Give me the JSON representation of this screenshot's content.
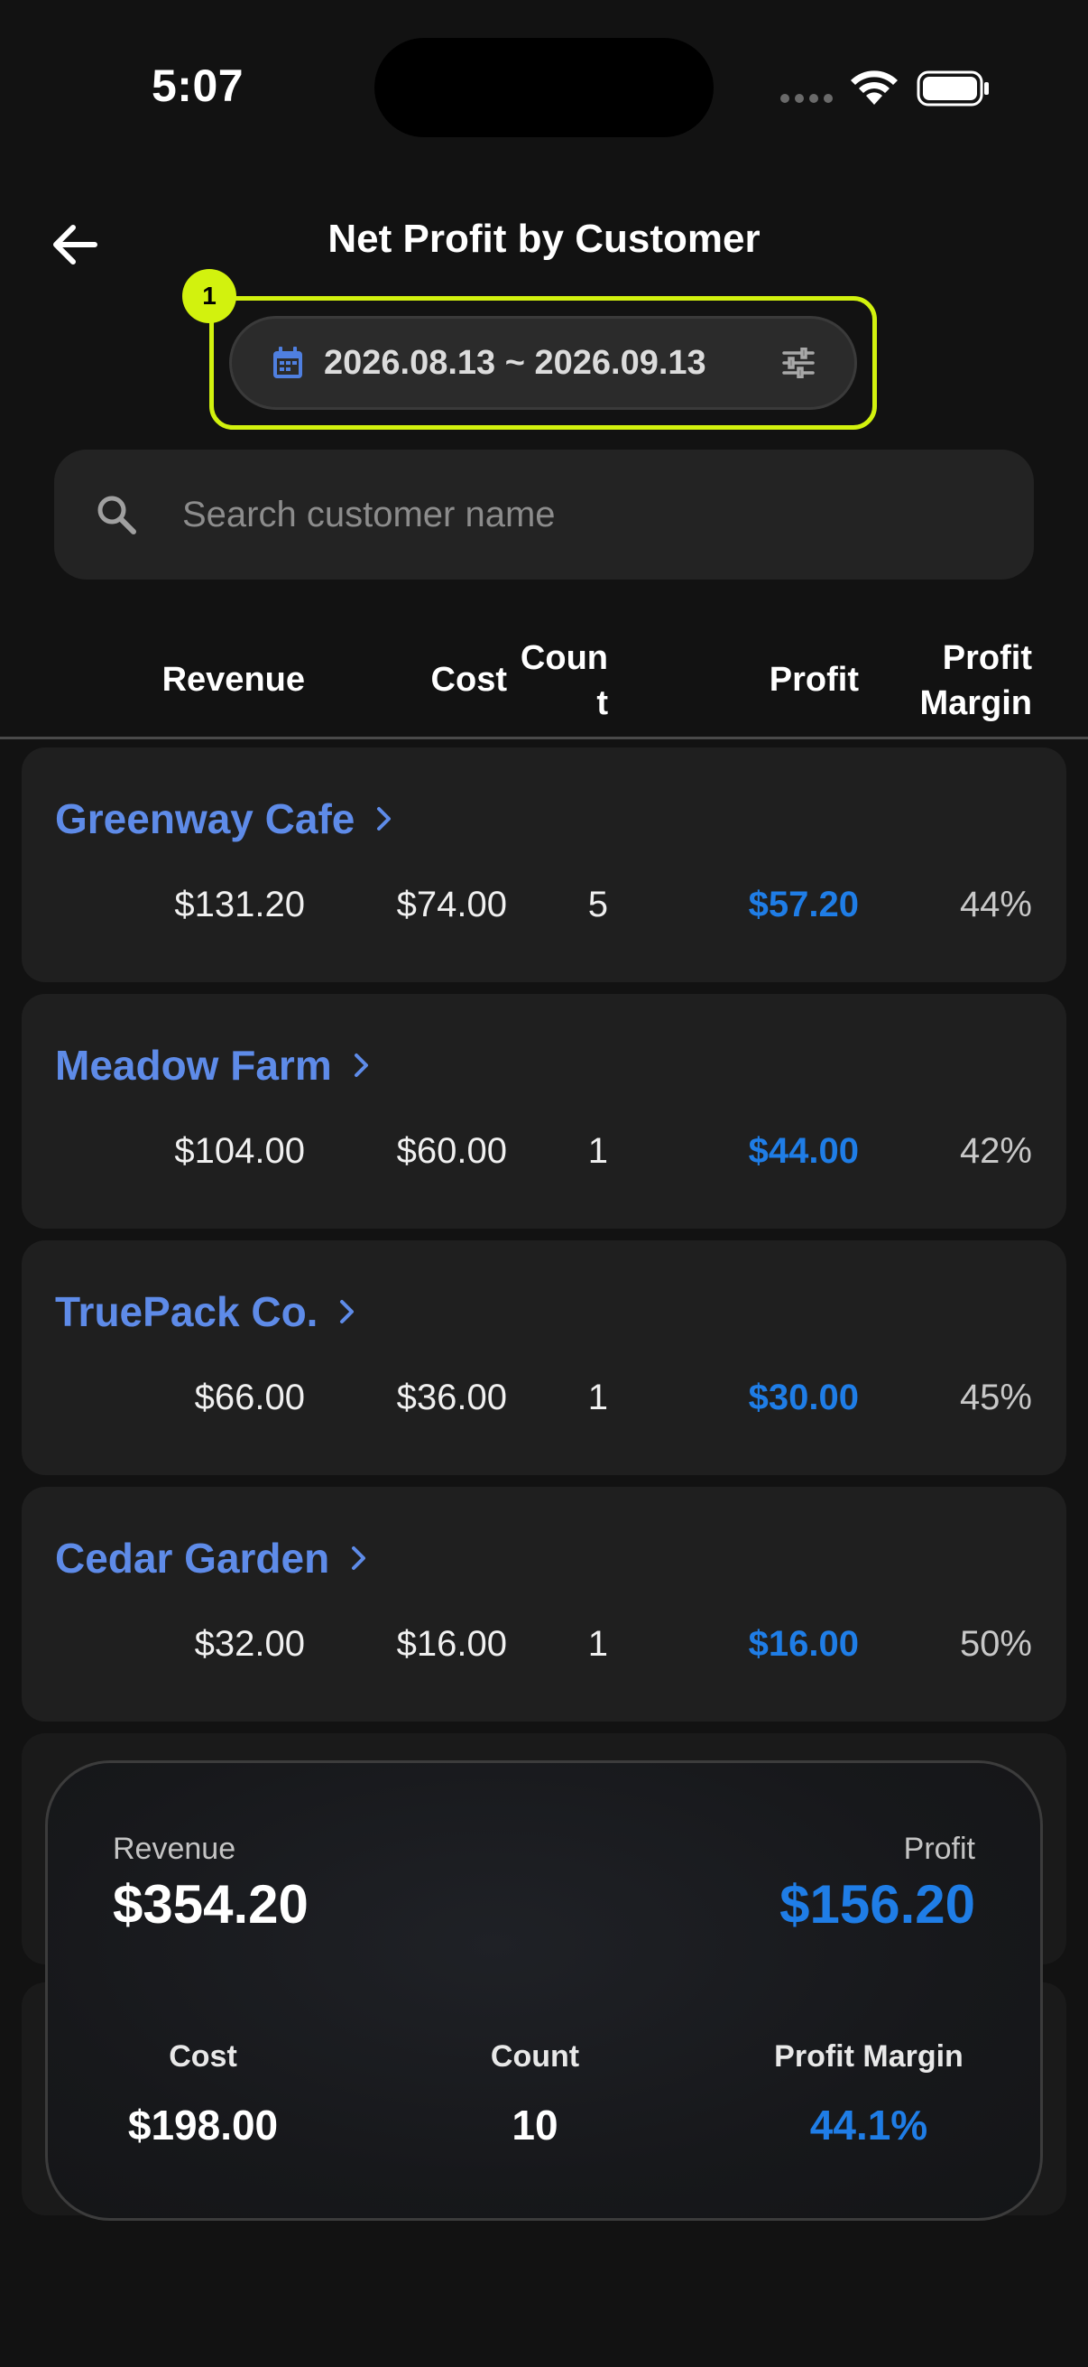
{
  "status": {
    "time": "5:07"
  },
  "header": {
    "title": "Net Profit by Customer"
  },
  "date_filter": {
    "badge": "1",
    "range": "2026.08.13 ~ 2026.09.13"
  },
  "search": {
    "placeholder": "Search customer name",
    "value": ""
  },
  "columns": {
    "revenue": "Revenue",
    "cost": "Cost",
    "count_line1": "Coun",
    "count_line2": "t",
    "profit": "Profit",
    "margin_line1": "Profit",
    "margin_line2": "Margin"
  },
  "customers": [
    {
      "name": "Greenway Cafe",
      "revenue": "$131.20",
      "cost": "$74.00",
      "count": "5",
      "profit": "$57.20",
      "margin": "44%"
    },
    {
      "name": "Meadow Farm",
      "revenue": "$104.00",
      "cost": "$60.00",
      "count": "1",
      "profit": "$44.00",
      "margin": "42%"
    },
    {
      "name": "TruePack Co.",
      "revenue": "$66.00",
      "cost": "$36.00",
      "count": "1",
      "profit": "$30.00",
      "margin": "45%"
    },
    {
      "name": "Cedar Garden",
      "revenue": "$32.00",
      "cost": "$16.00",
      "count": "1",
      "profit": "$16.00",
      "margin": "50%"
    }
  ],
  "summary": {
    "revenue_label": "Revenue",
    "revenue": "$354.20",
    "profit_label": "Profit",
    "profit": "$156.20",
    "cost_label": "Cost",
    "cost": "$198.00",
    "count_label": "Count",
    "count": "10",
    "margin_label": "Profit Margin",
    "margin": "44.1%"
  },
  "colors": {
    "accent_blue": "#1f7de6",
    "name_blue": "#5e8be8",
    "highlight": "#d2f20e",
    "background": "#121212"
  }
}
